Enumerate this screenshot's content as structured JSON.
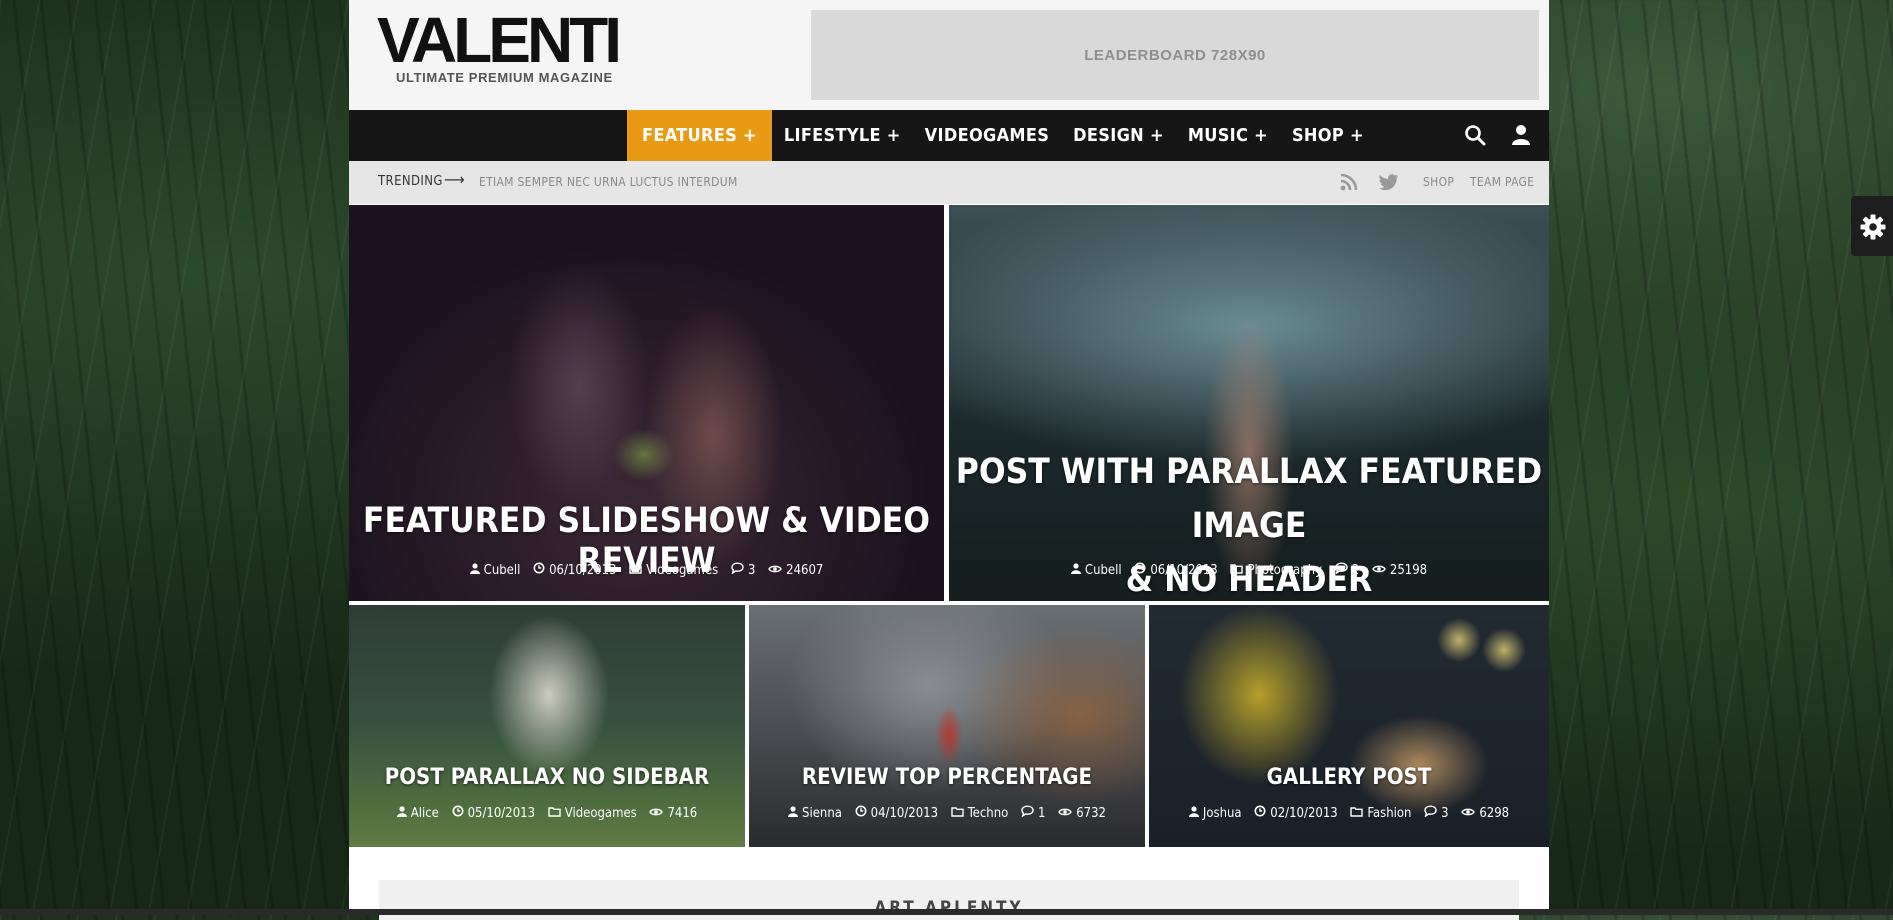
{
  "logo": {
    "name": "VALENTI",
    "tagline": "ULTIMATE PREMIUM MAGAZINE"
  },
  "ad": {
    "label": "LEADERBOARD 728X90"
  },
  "nav": {
    "items": [
      {
        "label": "FEATURES +"
      },
      {
        "label": "LIFESTYLE +"
      },
      {
        "label": "VIDEOGAMES"
      },
      {
        "label": "DESIGN +"
      },
      {
        "label": "MUSIC +"
      },
      {
        "label": "SHOP +"
      }
    ],
    "active_index": 0,
    "icons": [
      "search-icon",
      "user-icon"
    ]
  },
  "trending": {
    "label": "TRENDING",
    "arrow": "⟶",
    "headline": "ETIAM SEMPER NEC URNA LUCTUS INTERDUM",
    "social_icons": [
      "rss-icon",
      "twitter-icon"
    ],
    "links": [
      "SHOP",
      "TEAM PAGE"
    ]
  },
  "featured": [
    {
      "title": "FEATURED SLIDESHOW & VIDEO REVIEW",
      "author": "Cubell",
      "date": "06/10/2013",
      "category": "Videogames",
      "comments": "3",
      "views": "24607"
    },
    {
      "title_line1": "POST WITH PARALLAX FEATURED IMAGE",
      "title_line2": "& NO HEADER",
      "author": "Cubell",
      "date": "06/10/2013",
      "category": "Photography",
      "comments": "2",
      "views": "25198"
    },
    {
      "title": "POST PARALLAX NO SIDEBAR",
      "author": "Alice",
      "date": "05/10/2013",
      "category": "Videogames",
      "comments": "",
      "views": "7416"
    },
    {
      "title": "REVIEW TOP PERCENTAGE",
      "author": "Sienna",
      "date": "04/10/2013",
      "category": "Techno",
      "comments": "1",
      "views": "6732"
    },
    {
      "title": "GALLERY POST",
      "author": "Joshua",
      "date": "02/10/2013",
      "category": "Fashion",
      "comments": "3",
      "views": "6298"
    }
  ],
  "section": {
    "title": "ART APLENTY"
  },
  "colors": {
    "accent": "#e89a14",
    "nav_bg": "#161616",
    "header_bg": "#f5f5f5",
    "trending_bg": "#e6e6e6"
  }
}
